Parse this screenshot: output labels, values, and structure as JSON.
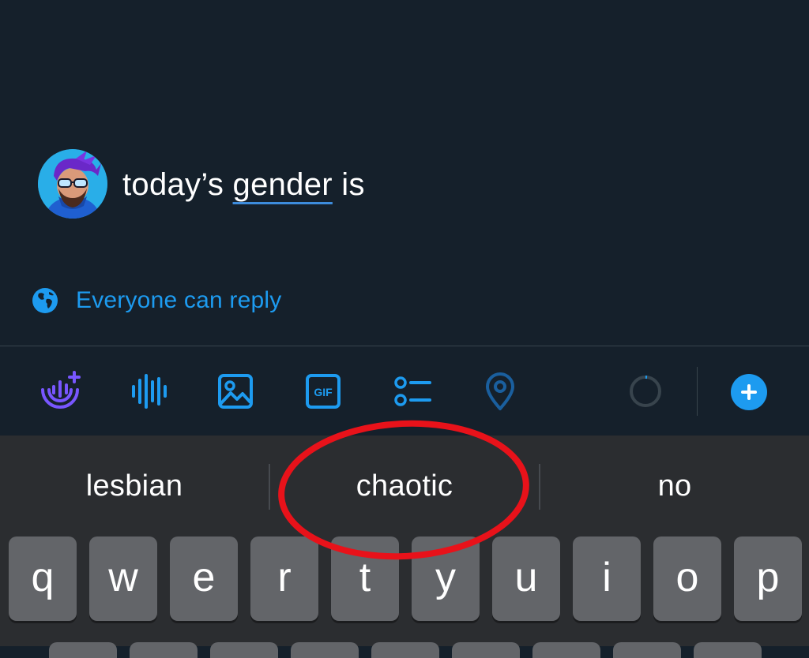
{
  "compose": {
    "tweet_text_before": "today’s ",
    "tweet_text_underlined": "gender",
    "tweet_text_after": " is",
    "reply_setting": "Everyone can reply"
  },
  "toolbar": {
    "icons": [
      "spaces-plus-icon",
      "voice-waveform-icon",
      "image-icon",
      "gif-icon",
      "poll-icon",
      "location-pin-icon",
      "character-count-ring",
      "add-tweet-icon"
    ],
    "gif_label": "GIF"
  },
  "keyboard": {
    "suggestions": [
      "lesbian",
      "chaotic",
      "no"
    ],
    "row1": [
      "q",
      "w",
      "e",
      "r",
      "t",
      "y",
      "u",
      "i",
      "o",
      "p"
    ]
  },
  "colors": {
    "background": "#15202b",
    "accent": "#1d9bf0",
    "keyboard_bg": "#2b2d30",
    "key_bg": "#636569",
    "annotation": "#e8121a"
  }
}
